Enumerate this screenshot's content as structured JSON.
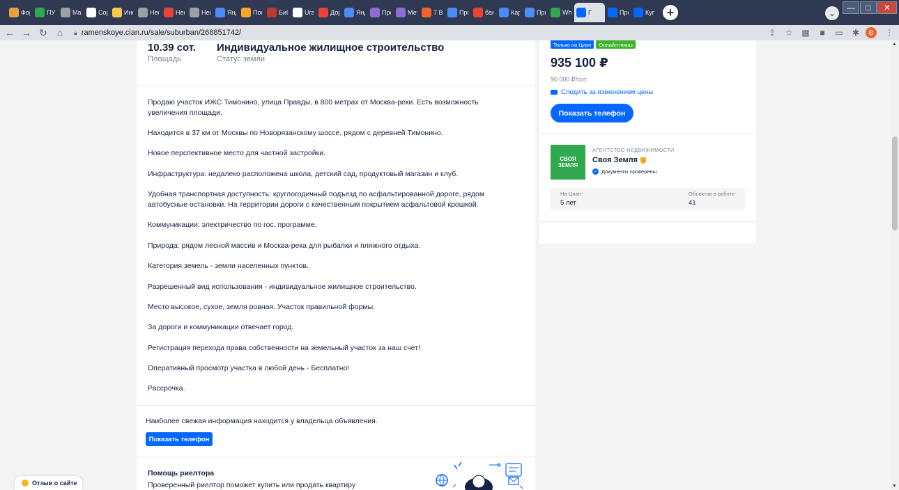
{
  "browser": {
    "tabs": [
      {
        "label": "Фор",
        "color": "#e6a23c"
      },
      {
        "label": "ПУ А",
        "color": "#2fa84f"
      },
      {
        "label": "Mach",
        "color": "#9aa0a6"
      },
      {
        "label": "Сорт",
        "color": "#ffffff"
      },
      {
        "label": "Инф",
        "color": "#f7c948"
      },
      {
        "label": "Нефт",
        "color": "#9aa0a6"
      },
      {
        "label": "Нефт",
        "color": "#ea4335"
      },
      {
        "label": "Нефт",
        "color": "#9aa0a6"
      },
      {
        "label": "Янд",
        "color": "#4c8bf5"
      },
      {
        "label": "Пом",
        "color": "#f5a623"
      },
      {
        "label": "Библ",
        "color": "#c0392b"
      },
      {
        "label": "Urals",
        "color": "#ffffff"
      },
      {
        "label": "Доро",
        "color": "#ea4335"
      },
      {
        "label": "Янд",
        "color": "#4c8bf5"
      },
      {
        "label": "Прог",
        "color": "#8e6bd8"
      },
      {
        "label": "Мет",
        "color": "#8e6bd8"
      },
      {
        "label": "7 В",
        "color": "#f2622e"
      },
      {
        "label": "При",
        "color": "#4c8bf5"
      },
      {
        "label": "банк",
        "color": "#ea4335"
      },
      {
        "label": "Карт",
        "color": "#4c8bf5"
      },
      {
        "label": "При",
        "color": "#4c8bf5"
      },
      {
        "label": "What",
        "color": "#2fa84f"
      },
      {
        "label": "Г",
        "color": "#0468ff",
        "active": true
      },
      {
        "label": "Прод",
        "color": "#0468ff"
      },
      {
        "label": "Купи",
        "color": "#0468ff"
      }
    ],
    "url": "ramenskoye.cian.ru/sale/suburban/268851742/",
    "avatar_letter": "В"
  },
  "facts": [
    {
      "value": "10.39 сот.",
      "label": "Площадь"
    },
    {
      "value": "Индивидуальное жилищное строительство",
      "label": "Статус земли"
    }
  ],
  "description": [
    "Продаю участок ИЖС Тимонино, улица Правды,  в 800 метрах от Москва-реки. Есть возможность увеличения площади.",
    "Находится в 37 км от Москвы по Новорязанскому шоссе, рядом с деревней Тимонино.",
    "Новое перспективное место для частной застройки.",
    "Инфраструктура: недалеко расположена школа, детский сад, продуктовый магазин и клуб.",
    "Удобная транспортная доступность: круглогодичный подъезд по асфальтированной дороге, рядом автобусные остановки. На территории дороги с качественным покрытием асфальтовой крошкой.",
    "Коммуникации: электричество по гос. программе.",
    "Природа: рядом лесной массив и Москва-река для рыбалки и пляжного отдыха.",
    "Категория земель - земли населенных пунктов.",
    "Разрешенный вид использования - индивидуальное жилищное строительство.",
    "Место высокое, сухое, земля ровная. Участок правильной формы.",
    "За дороги и коммуникации отвечает город.",
    "Регистрация перехода права собственности на земельный участок за наш счет!",
    "Оперативный просмотр участка в любой день - Бесплатно!",
    "Рассрочка."
  ],
  "owner_note": "Наиболее свежая информация находится у владельца объявления.",
  "show_phone_small": "Показать телефон",
  "realtor": {
    "title": "Помощь риелтора",
    "subtitle": "Проверенный риелтор поможет купить или продать квартиру"
  },
  "sidebar": {
    "badge_cian": "Только на Циан",
    "badge_online": "Онлайн-показ",
    "price": "935 100 ₽",
    "price_per": "90 000 ₽/сот.",
    "watch_price": "Следить за изменением цены",
    "show_phone": "Показать телефон",
    "agency": {
      "logo_text": "СВОЯ ЗЕМЛЯ",
      "type": "АГЕНТСТВО НЕДВИЖИМОСТИ",
      "name": "Своя Земля",
      "verified": "Документы проверены",
      "stats": [
        {
          "key": "На Циан",
          "value": "5 лет"
        },
        {
          "key": "Объектов в работе",
          "value": "41"
        }
      ]
    }
  },
  "feedback": "Отзыв о сайте",
  "colors": {
    "accent": "#0468ff",
    "online": "#3eb42b",
    "text": "#152242",
    "muted": "#7a7f8c"
  }
}
